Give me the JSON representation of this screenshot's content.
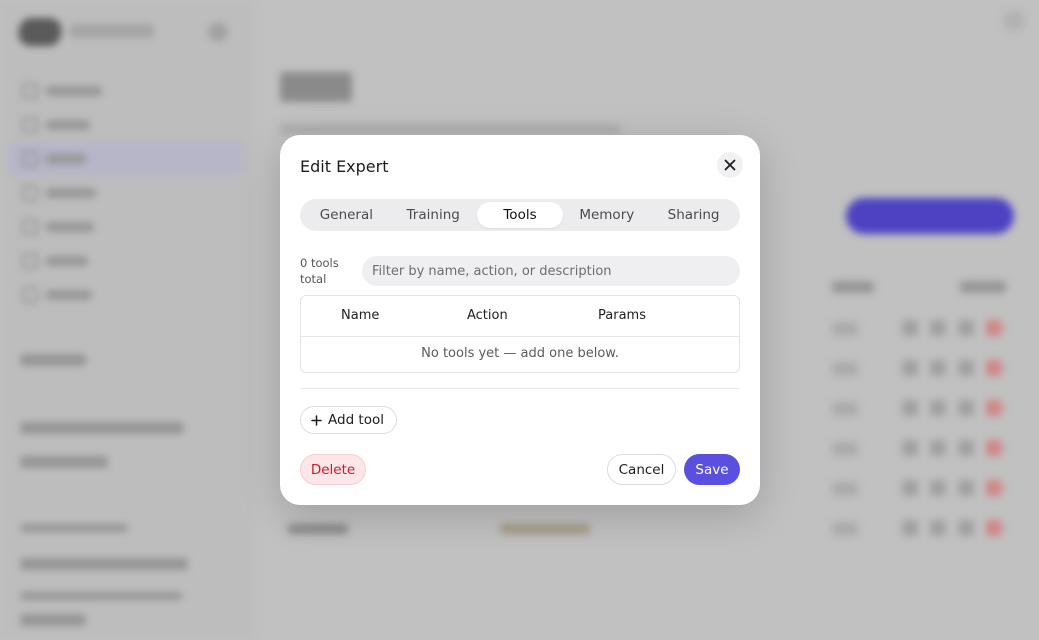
{
  "modal": {
    "title": "Edit Expert",
    "tabs": [
      {
        "label": "General"
      },
      {
        "label": "Training"
      },
      {
        "label": "Tools",
        "active": true
      },
      {
        "label": "Memory"
      },
      {
        "label": "Sharing"
      }
    ],
    "tools_count": "0 tools total",
    "filter": {
      "placeholder": "Filter by name, action, or description",
      "value": ""
    },
    "table": {
      "columns": [
        "Name",
        "Action",
        "Params"
      ],
      "empty_message": "No tools yet — add one below."
    },
    "add_tool_label": "Add tool",
    "buttons": {
      "delete": "Delete",
      "cancel": "Cancel",
      "save": "Save"
    }
  },
  "icons": {
    "close": "close-icon",
    "add": "plus-icon"
  },
  "colors": {
    "accent": "#5b4fe0",
    "danger": "#c81d2a",
    "danger_bg": "#fde6e8"
  }
}
